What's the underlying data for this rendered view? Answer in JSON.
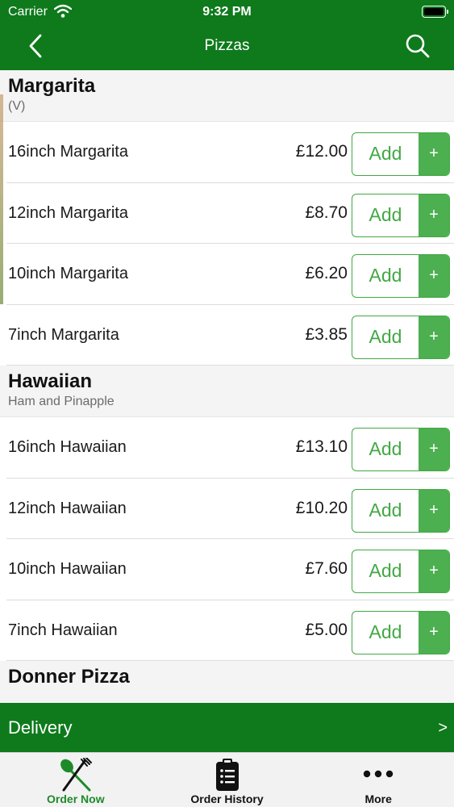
{
  "status_bar": {
    "carrier": "Carrier",
    "time": "9:32 PM"
  },
  "nav": {
    "title": "Pizzas"
  },
  "sections": [
    {
      "title": "Margarita",
      "subtitle": "(V)",
      "items": [
        {
          "name": "16inch Margarita",
          "price": "£12.00"
        },
        {
          "name": "12inch Margarita",
          "price": "£8.70"
        },
        {
          "name": "10inch Margarita",
          "price": "£6.20"
        },
        {
          "name": "7inch Margarita",
          "price": "£3.85"
        }
      ]
    },
    {
      "title": "Hawaiian",
      "subtitle": "Ham and Pinapple",
      "items": [
        {
          "name": "16inch Hawaiian",
          "price": "£13.10"
        },
        {
          "name": "12inch Hawaiian",
          "price": "£10.20"
        },
        {
          "name": "10inch Hawaiian",
          "price": "£7.60"
        },
        {
          "name": "7inch Hawaiian",
          "price": "£5.00"
        }
      ]
    },
    {
      "title": "Donner Pizza",
      "subtitle": ""
    }
  ],
  "add_label": "Add",
  "add_plus": "+",
  "delivery": {
    "label": "Delivery",
    "arrow": ">"
  },
  "tabs": [
    {
      "label": "Order Now",
      "icon": "fork-knife-icon"
    },
    {
      "label": "Order History",
      "icon": "clipboard-list-icon"
    },
    {
      "label": "More",
      "icon": "more-dots-icon"
    }
  ],
  "colors": {
    "brand_green": "#0e7a1c",
    "accent_green": "#4caf50",
    "active_tab": "#1d8a2a"
  }
}
